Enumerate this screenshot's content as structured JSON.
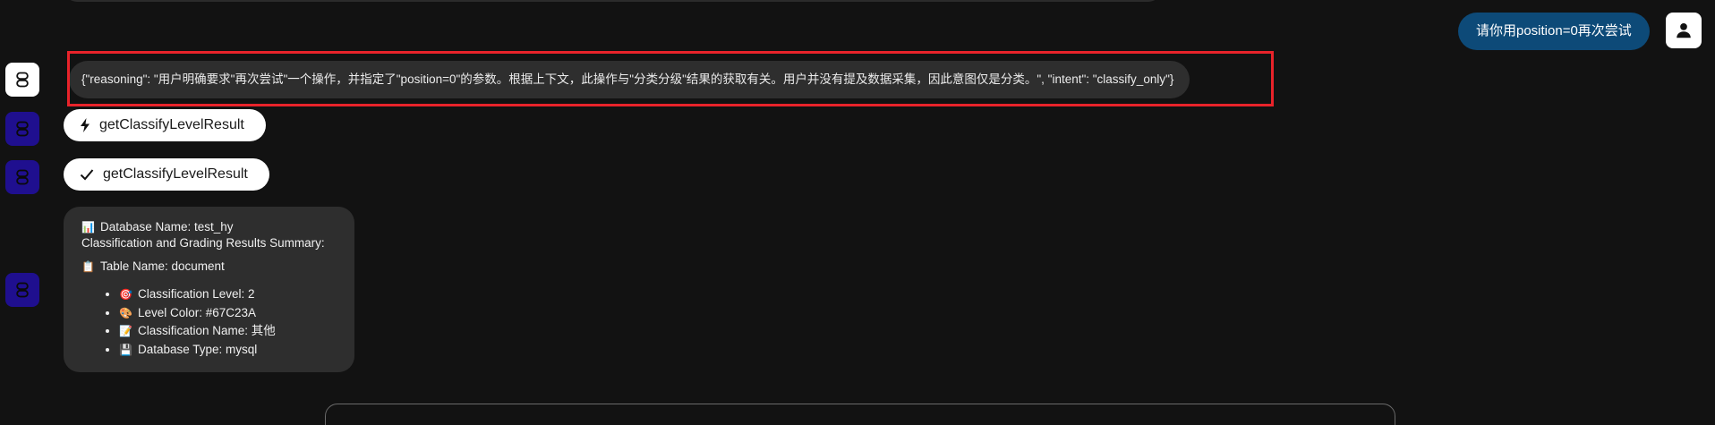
{
  "user_message": "请你用position=0再次尝试",
  "reasoning_text": "{\"reasoning\": \"用户明确要求\"再次尝试\"一个操作，并指定了\"position=0\"的参数。根据上下文，此操作与\"分类分级\"结果的获取有关。用户并没有提及数据采集，因此意图仅是分类。\", \"intent\": \"classify_only\"}",
  "tool_calls": [
    {
      "icon": "lightning-icon",
      "label": "getClassifyLevelResult",
      "state": "running"
    },
    {
      "icon": "check-icon",
      "label": "getClassifyLevelResult",
      "state": "done"
    }
  ],
  "result": {
    "database_line": "Database Name: test_hy",
    "summary_line": "Classification and Grading Results Summary:",
    "table_line": "Table Name: document",
    "items": [
      {
        "emoji": "🎯",
        "text": "Classification Level: 2"
      },
      {
        "emoji": "🎨",
        "text": "Level Color: #67C23A"
      },
      {
        "emoji": "📝",
        "text": "Classification Name: 其他"
      },
      {
        "emoji": "💾",
        "text": "Database Type: mysql"
      }
    ],
    "db_emoji": "📊",
    "table_emoji": "📋"
  },
  "colors": {
    "background": "#121212",
    "user_bubble": "#0d4a78",
    "bubble": "#2e2e2e",
    "highlight": "#e8232a",
    "bot_avatar_dark": "#1f0f8f"
  }
}
